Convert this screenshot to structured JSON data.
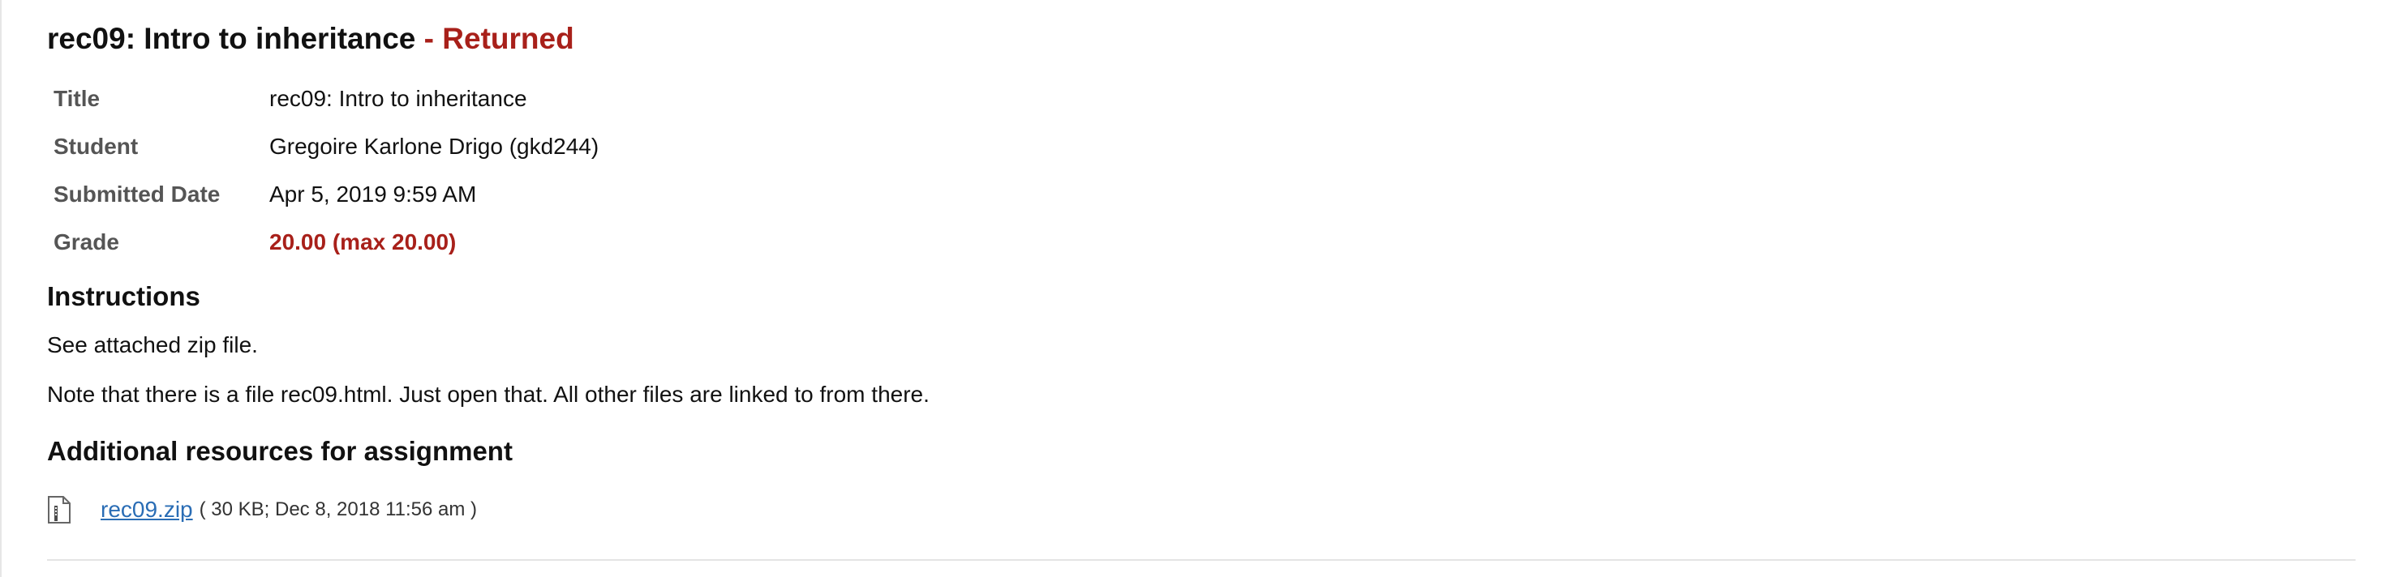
{
  "header": {
    "title": "rec09: Intro to inheritance",
    "status": "- Returned"
  },
  "details": [
    {
      "label": "Title",
      "value": "rec09: Intro to inheritance"
    },
    {
      "label": "Student",
      "value": "Gregoire Karlone Drigo (gkd244)"
    },
    {
      "label": "Submitted Date",
      "value": "Apr 5, 2019 9:59 AM"
    },
    {
      "label": "Grade",
      "value": "20.00 (max 20.00)"
    }
  ],
  "instructions": {
    "heading": "Instructions",
    "paragraphs": [
      "See attached zip file.",
      "Note that there is a file rec09.html. Just open that. All other files are linked to from there."
    ]
  },
  "resources": {
    "heading": "Additional resources for assignment",
    "files": [
      {
        "icon": "zip-file-icon",
        "name": "rec09.zip",
        "meta": "( 30 KB; Dec 8, 2018 11:56 am )"
      }
    ]
  },
  "colors": {
    "status_red": "#a8201a",
    "link_blue": "#2a6db5",
    "label_gray": "#555555"
  }
}
